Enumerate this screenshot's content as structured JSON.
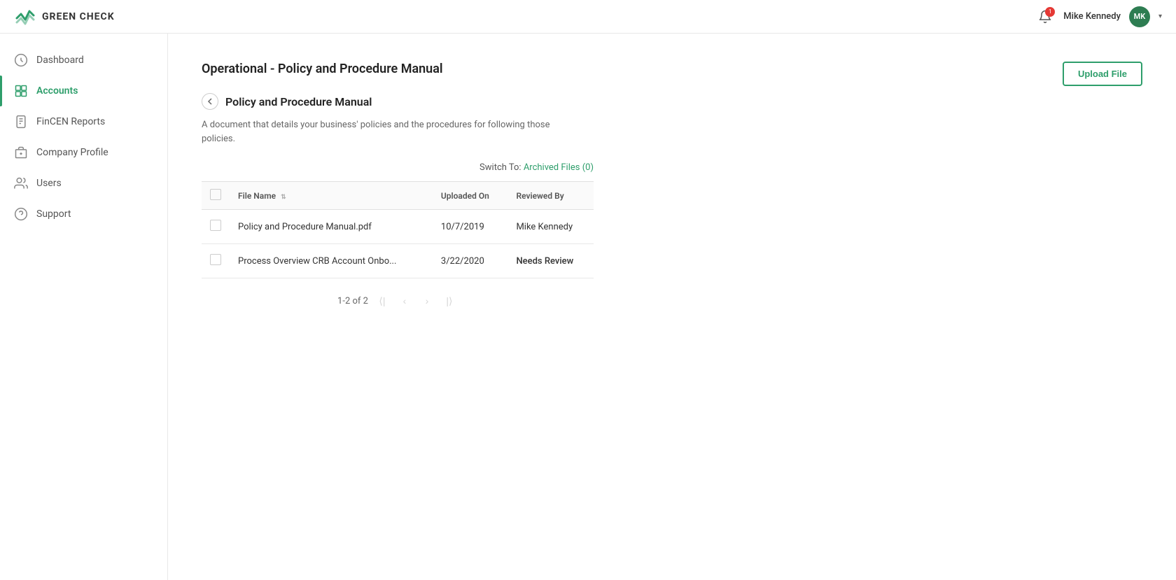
{
  "brand": {
    "name": "GREEN CHECK"
  },
  "user": {
    "name": "Mike Kennedy",
    "initials": "MK",
    "notification_count": "1"
  },
  "sidebar": {
    "items": [
      {
        "id": "dashboard",
        "label": "Dashboard",
        "active": false,
        "icon": "dashboard-icon"
      },
      {
        "id": "accounts",
        "label": "Accounts",
        "active": true,
        "icon": "accounts-icon"
      },
      {
        "id": "fincen-reports",
        "label": "FinCEN Reports",
        "active": false,
        "icon": "fincen-icon"
      },
      {
        "id": "company-profile",
        "label": "Company Profile",
        "active": false,
        "icon": "company-icon"
      },
      {
        "id": "users",
        "label": "Users",
        "active": false,
        "icon": "users-icon"
      },
      {
        "id": "support",
        "label": "Support",
        "active": false,
        "icon": "support-icon"
      }
    ]
  },
  "page": {
    "title": "Operational - Policy and Procedure Manual",
    "section_title": "Policy and Procedure Manual",
    "description": "A document that details your business' policies and the procedures for following those policies.",
    "upload_button": "Upload File",
    "switch_to_label": "Switch To:",
    "archived_files_label": "Archived Files (0)"
  },
  "table": {
    "columns": [
      {
        "id": "file-name",
        "label": "File Name",
        "sortable": true
      },
      {
        "id": "uploaded-on",
        "label": "Uploaded On",
        "sortable": false
      },
      {
        "id": "reviewed-by",
        "label": "Reviewed By",
        "sortable": false
      }
    ],
    "rows": [
      {
        "id": "row-1",
        "file_name": "Policy and Procedure Manual.pdf",
        "uploaded_on": "10/7/2019",
        "reviewed_by": "Mike Kennedy",
        "status": null
      },
      {
        "id": "row-2",
        "file_name": "Process Overview CRB Account Onbo...",
        "uploaded_on": "3/22/2020",
        "reviewed_by": "Needs Review",
        "status": "needs-review"
      }
    ]
  },
  "pagination": {
    "info": "1-2 of 2"
  }
}
